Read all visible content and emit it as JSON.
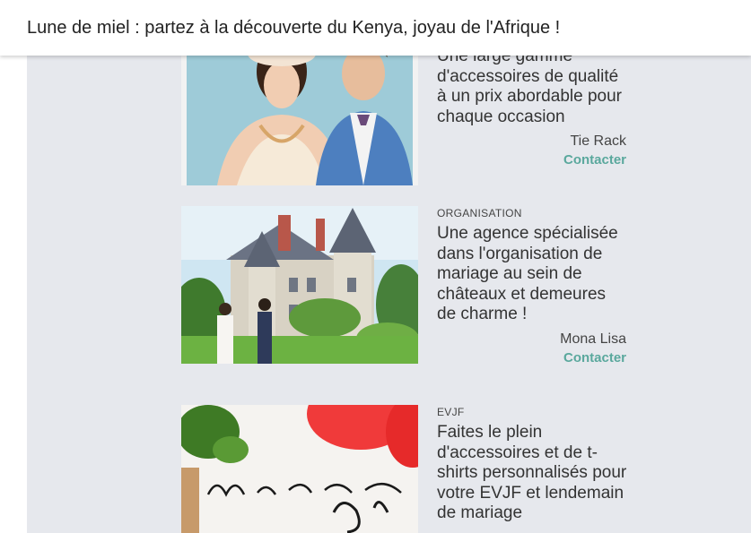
{
  "banner": {
    "text": "Lune de miel : partez à la découverte du Kenya, joyau de l'Afrique !"
  },
  "cards": [
    {
      "category": "",
      "description": "Une large gamme d'accessoires de qualité à un prix abordable pour chaque occasion",
      "vendor": "Tie Rack",
      "contact_label": "Contacter"
    },
    {
      "category": "ORGANISATION",
      "description": "Une agence spécialisée dans l'organisation de mariage au sein de châteaux et demeures de charme !",
      "vendor": "Mona Lisa",
      "contact_label": "Contacter"
    },
    {
      "category": "EVJF",
      "description": "Faites le plein d'accessoires et de t-shirts personnalisés pour votre EVJF et lendemain de mariage"
    }
  ],
  "colors": {
    "accent": "#5aa89d",
    "background": "#e6e8ed"
  }
}
